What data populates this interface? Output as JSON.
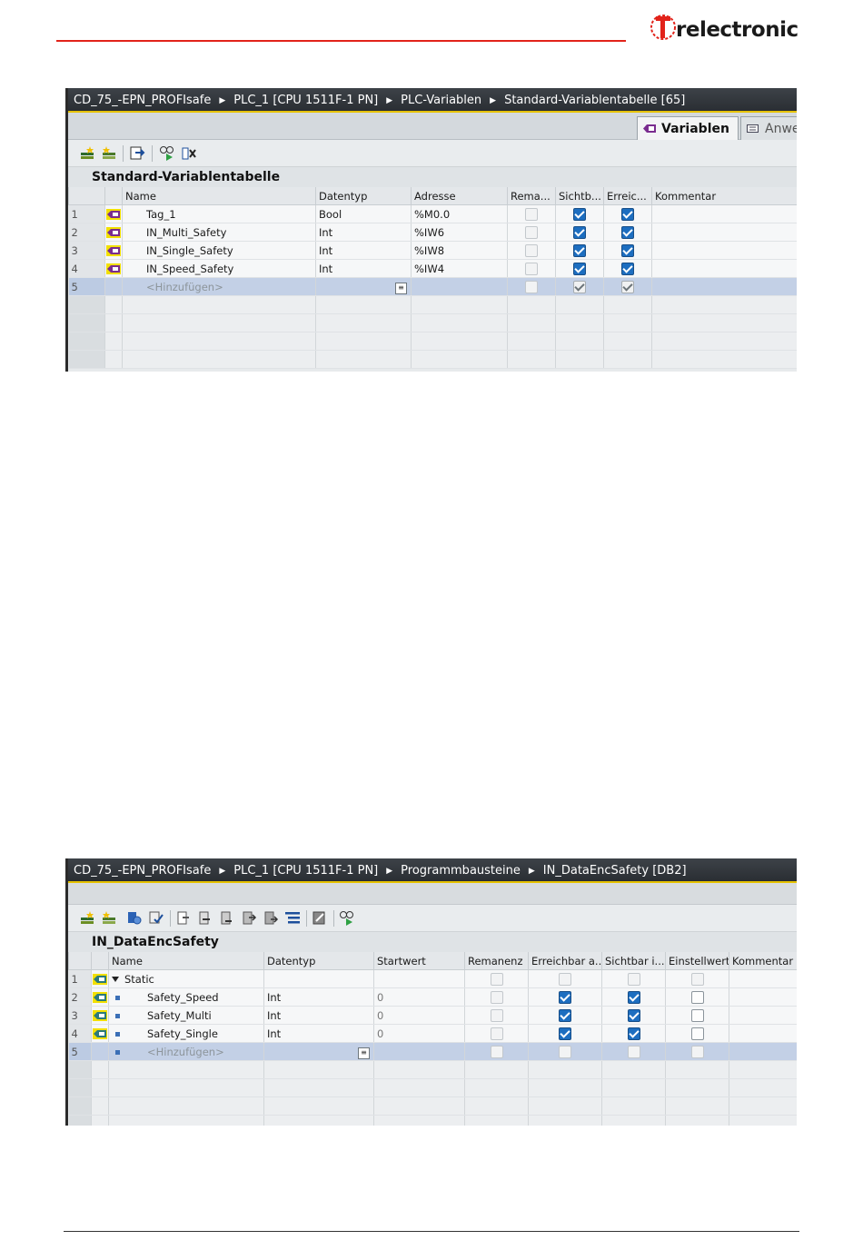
{
  "brand": {
    "logo_text": "relectronic",
    "logo_letters": "TR"
  },
  "screen1": {
    "breadcrumb": [
      "CD_75_-EPN_PROFIsafe",
      "PLC_1 [CPU 1511F-1 PN]",
      "PLC-Variablen",
      "Standard-Variablentabelle [65]"
    ],
    "tabs": [
      {
        "label": "Variablen",
        "active": true
      },
      {
        "label": "Anwe",
        "active": false
      }
    ],
    "table_title": "Standard-Variablentabelle",
    "columns": [
      "",
      "",
      "Name",
      "Datentyp",
      "Adresse",
      "Rema...",
      "Sichtb...",
      "Erreic...",
      "Kommentar"
    ],
    "rows": [
      {
        "num": "1",
        "name": "Tag_1",
        "type": "Bool",
        "address": "%M0.0",
        "remanent": false,
        "visible": true,
        "reachable": true,
        "comment": ""
      },
      {
        "num": "2",
        "name": "IN_Multi_Safety",
        "type": "Int",
        "address": "%IW6",
        "remanent": false,
        "visible": true,
        "reachable": true,
        "comment": ""
      },
      {
        "num": "3",
        "name": "IN_Single_Safety",
        "type": "Int",
        "address": "%IW8",
        "remanent": false,
        "visible": true,
        "reachable": true,
        "comment": ""
      },
      {
        "num": "4",
        "name": "IN_Speed_Safety",
        "type": "Int",
        "address": "%IW4",
        "remanent": false,
        "visible": true,
        "reachable": true,
        "comment": ""
      },
      {
        "num": "5",
        "name": "<Hinzufügen>",
        "type": "",
        "address": "",
        "remanent": false,
        "visible": true,
        "reachable": true,
        "comment": ""
      }
    ]
  },
  "screen2": {
    "breadcrumb": [
      "CD_75_-EPN_PROFIsafe",
      "PLC_1 [CPU 1511F-1 PN]",
      "Programmbausteine",
      "IN_DataEncSafety [DB2]"
    ],
    "table_title": "IN_DataEncSafety",
    "columns": [
      "",
      "",
      "Name",
      "Datentyp",
      "Startwert",
      "Remanenz",
      "Erreichbar a...",
      "Sichtbar i...",
      "Einstellwert",
      "Kommentar"
    ],
    "rows": [
      {
        "num": "1",
        "name": "Static",
        "type": "",
        "start": "",
        "remanent": false,
        "reachable": false,
        "visible": false,
        "setpoint": false
      },
      {
        "num": "2",
        "name": "Safety_Speed",
        "type": "Int",
        "start": "0",
        "remanent": false,
        "reachable": true,
        "visible": true,
        "setpoint": false
      },
      {
        "num": "3",
        "name": "Safety_Multi",
        "type": "Int",
        "start": "0",
        "remanent": false,
        "reachable": true,
        "visible": true,
        "setpoint": false
      },
      {
        "num": "4",
        "name": "Safety_Single",
        "type": "Int",
        "start": "0",
        "remanent": false,
        "reachable": true,
        "visible": true,
        "setpoint": false
      },
      {
        "num": "5",
        "name": "<Hinzufügen>",
        "type": "",
        "start": "",
        "remanent": false,
        "reachable": false,
        "visible": false,
        "setpoint": false
      }
    ]
  },
  "colors": {
    "accent_red": "#e2231a",
    "header_dark": "#2f3338",
    "check_blue": "#1d6ec0",
    "selection": "#c3d0e6"
  }
}
